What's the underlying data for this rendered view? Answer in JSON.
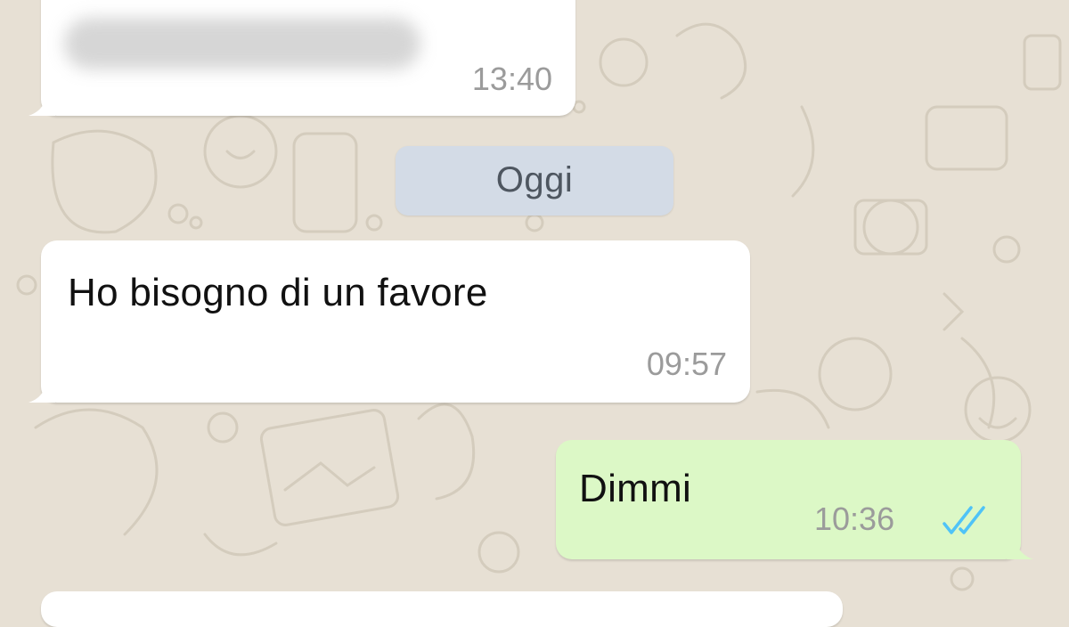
{
  "chat": {
    "date_separator": "Oggi",
    "messages": [
      {
        "direction": "incoming",
        "text": "",
        "text_blurred": true,
        "time": "13:40"
      },
      {
        "direction": "incoming",
        "text": "Ho bisogno di un favore",
        "time": "09:57"
      },
      {
        "direction": "outgoing",
        "text": "Dimmi",
        "time": "10:36",
        "status": "read"
      }
    ]
  },
  "colors": {
    "wallpaper": "#e7e0d4",
    "incoming_bubble": "#ffffff",
    "outgoing_bubble": "#dcf8c6",
    "date_pill": "#d3dbe6",
    "read_ticks": "#4fc3f7",
    "time_text": "#9b9b9b"
  },
  "icons": {
    "read_receipt": "double-check-icon",
    "wallpaper": "doodle-pattern"
  }
}
